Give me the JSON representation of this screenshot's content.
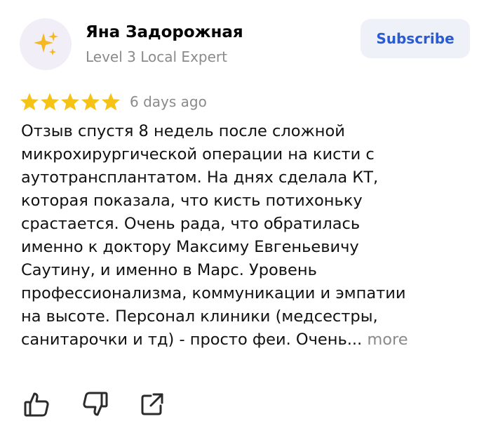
{
  "author": {
    "avatar_icon": "sparkles-icon",
    "name": "Яна Задорожная",
    "level": "Level 3 Local Expert"
  },
  "subscribe_label": "Subscribe",
  "review": {
    "rating": 5,
    "max_rating": 5,
    "date": "6 days ago",
    "text_lines": [
      "Отзыв спустя 8 недель после сложной",
      "микрохирургической операции на кисти с",
      "аутотрансплантатом. На днях сделала КТ,",
      "которая показала, что кисть потихоньку",
      "срастается. Очень рада, что обратилась",
      "именно к доктору Максиму Евгеньевичу",
      "Саутину, и именно в Марс. Уровень",
      "профессионализма, коммуникации и эмпатии",
      "на высоте. Персонал клиники (медсестры,",
      "санитарочки и тд) - просто феи. Очень..."
    ],
    "more_label": "more"
  },
  "actions": {
    "like_icon": "thumbs-up-icon",
    "dislike_icon": "thumbs-down-icon",
    "share_icon": "share-icon"
  },
  "colors": {
    "star": "#f5c315",
    "accent": "#2a5bd7",
    "muted": "#8a8a8a",
    "button_bg": "#eef2f8",
    "avatar_bg": "#f1eef7",
    "icon": "#2b2b2b"
  }
}
